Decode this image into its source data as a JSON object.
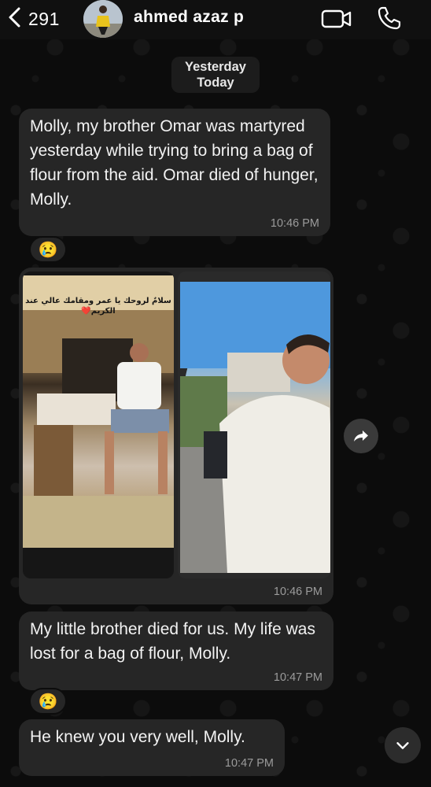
{
  "header": {
    "back_count": "291",
    "contact_name": "ahmed azaz p"
  },
  "date_separator": {
    "line1": "Yesterday",
    "line2": "Today"
  },
  "messages": [
    {
      "text": "Molly, my brother Omar was martyred yesterday while trying to bring a bag of flour from the aid. Omar died of hunger, Molly.",
      "time": "10:46 PM",
      "reaction": "😢"
    },
    {
      "type": "images",
      "image_caption": "سلامٌ لروحك يا عمر ومقامك عالي عند الكريم❤️",
      "time": "10:46 PM"
    },
    {
      "text": "My little brother died for us. My life was lost for a bag of flour, Molly.",
      "time": "10:47 PM",
      "reaction": "😢"
    },
    {
      "text": "He knew you very well, Molly.",
      "time": "10:47 PM"
    }
  ],
  "icons": {
    "back": "chevron-left-icon",
    "video": "video-camera-icon",
    "call": "phone-icon",
    "share": "share-arrow-icon",
    "scroll_down": "chevron-down-icon"
  },
  "colors": {
    "bubble": "#262626",
    "background": "#0b0b0b",
    "timestamp": "#9b9b9b"
  }
}
